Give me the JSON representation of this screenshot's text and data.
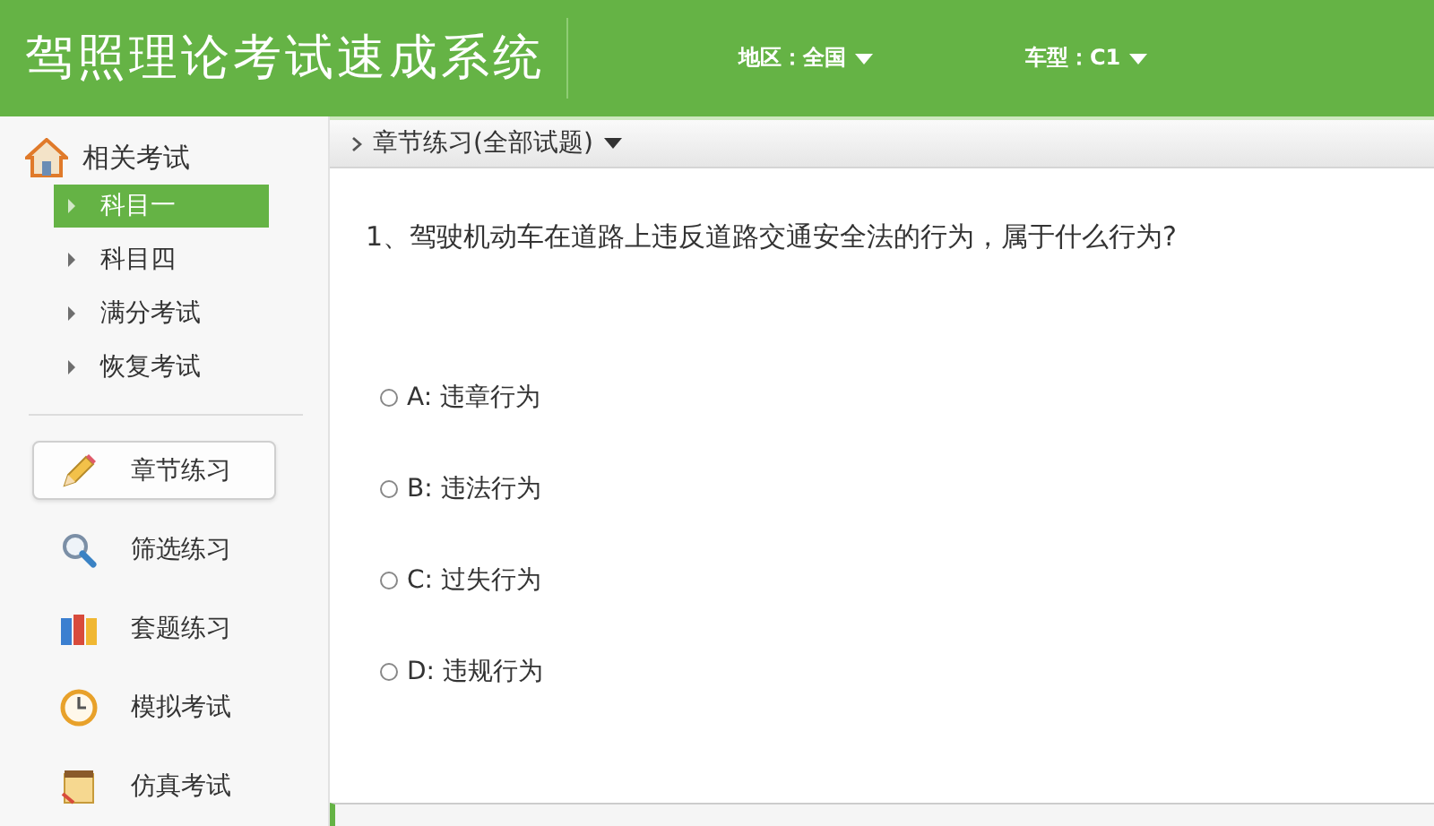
{
  "header": {
    "title": "驾照理论考试速成系统",
    "filters": [
      {
        "label": "地区：全国"
      },
      {
        "label": "车型：C1"
      }
    ]
  },
  "sidebar": {
    "section": {
      "title": "相关考试",
      "items": [
        {
          "label": "科目一",
          "selected": true
        },
        {
          "label": "科目四",
          "selected": false
        },
        {
          "label": "满分考试",
          "selected": false
        },
        {
          "label": "恢复考试",
          "selected": false
        }
      ]
    },
    "tools": [
      {
        "label": "章节练习",
        "kind": "pencil",
        "selected": true
      },
      {
        "label": "筛选练习",
        "kind": "magnifier",
        "selected": false
      },
      {
        "label": "套题练习",
        "kind": "books",
        "selected": false
      },
      {
        "label": "模拟考试",
        "kind": "clock",
        "selected": false
      },
      {
        "label": "仿真考试",
        "kind": "notepad",
        "selected": false
      }
    ]
  },
  "breadcrumb": {
    "label": "章节练习(全部试题)"
  },
  "question": {
    "text": "1、驾驶机动车在道路上违反道路交通安全法的行为，属于什么行为?",
    "options": [
      {
        "label": "A: 违章行为",
        "selected": false
      },
      {
        "label": "B: 违法行为",
        "selected": false
      },
      {
        "label": "C: 过失行为",
        "selected": false
      },
      {
        "label": "D: 违规行为",
        "selected": false
      }
    ]
  }
}
